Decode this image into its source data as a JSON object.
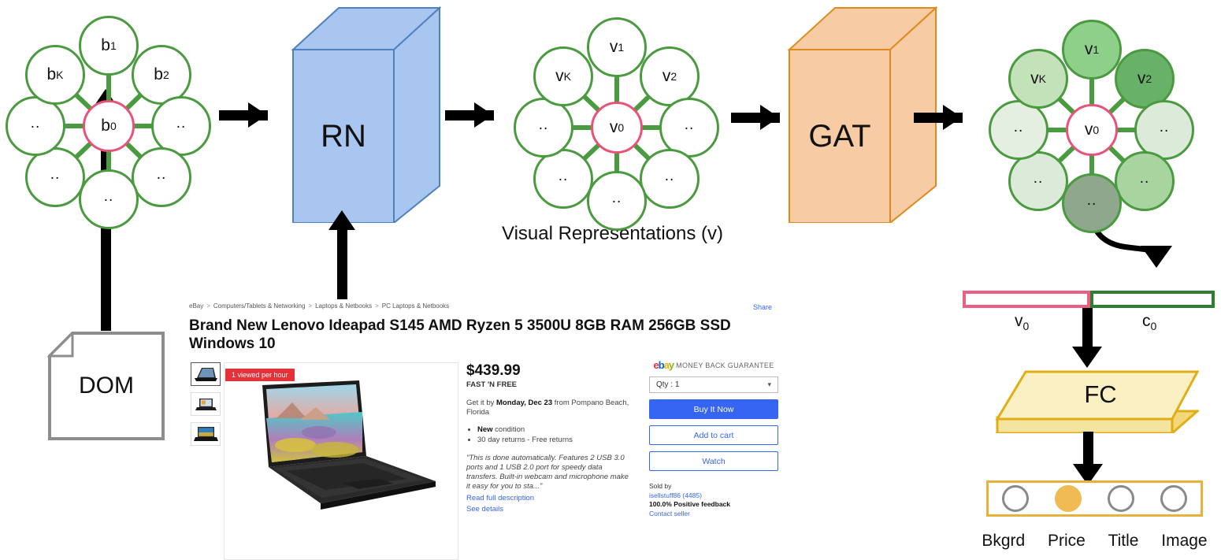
{
  "pipeline": {
    "stage1_label": "DOM",
    "rn_label": "RN",
    "gat_label": "GAT",
    "visual_caption": "Visual Representations (v)",
    "fc_label": "FC"
  },
  "graph_dom": {
    "center": "b",
    "center_sub": "0",
    "nodes": [
      {
        "label": "b",
        "sub": "1"
      },
      {
        "label": "b",
        "sub": "2"
      },
      {
        "label": "..",
        "sub": ""
      },
      {
        "label": "..",
        "sub": ""
      },
      {
        "label": "..",
        "sub": ""
      },
      {
        "label": "..",
        "sub": ""
      },
      {
        "label": "..",
        "sub": ""
      },
      {
        "label": "b",
        "sub": "K"
      }
    ]
  },
  "graph_visual": {
    "center": "v",
    "center_sub": "0",
    "nodes": [
      {
        "label": "v",
        "sub": "1"
      },
      {
        "label": "v",
        "sub": "2"
      },
      {
        "label": "..",
        "sub": ""
      },
      {
        "label": "..",
        "sub": ""
      },
      {
        "label": "..",
        "sub": ""
      },
      {
        "label": "..",
        "sub": ""
      },
      {
        "label": "..",
        "sub": ""
      },
      {
        "label": "v",
        "sub": "K"
      }
    ]
  },
  "graph_attention": {
    "center": "v",
    "center_sub": "0",
    "nodes": [
      {
        "label": "v",
        "sub": "1",
        "fill": "#8ed08a"
      },
      {
        "label": "v",
        "sub": "2",
        "fill": "#68b168"
      },
      {
        "label": "..",
        "sub": "",
        "fill": "#dcead9"
      },
      {
        "label": "..",
        "sub": "",
        "fill": "#a8d4a0"
      },
      {
        "label": "..",
        "sub": "",
        "fill": "#8fa78c"
      },
      {
        "label": "..",
        "sub": "",
        "fill": "#dcead9"
      },
      {
        "label": "..",
        "sub": "",
        "fill": "#e4efe1"
      },
      {
        "label": "v",
        "sub": "K",
        "fill": "#c4e2ba"
      }
    ]
  },
  "concat": {
    "v_label": "v",
    "v_sub": "0",
    "v_color": "#ec5f84",
    "c_label": "c",
    "c_sub": "0",
    "c_color": "#2e7d32"
  },
  "output": {
    "classes": [
      "Bkgrd",
      "Price",
      "Title",
      "Image"
    ],
    "selected_index": 1,
    "accent": "#e8b13c",
    "active_fill": "#f0bb55"
  },
  "ebay": {
    "breadcrumb": [
      "eBay",
      "Computers/Tablets & Networking",
      "Laptops & Netbooks",
      "PC Laptops & Netbooks"
    ],
    "share_label": "Share",
    "title": "Brand New Lenovo Ideapad S145 AMD Ryzen 5 3500U 8GB RAM 256GB SSD Windows 10",
    "viewed_badge": "1 viewed per hour",
    "price": "$439.99",
    "shipping_tag": "FAST 'N FREE",
    "get_it_prefix": "Get it by ",
    "get_it_date": "Monday, Dec 23",
    "get_it_suffix": " from Pompano Beach, Florida",
    "bullets": [
      {
        "strong": "New",
        "rest": " condition"
      },
      {
        "strong": "",
        "rest": "30 day returns - Free returns"
      }
    ],
    "description": "\"This is done automatically. Features 2 USB 3.0 ports and 1 USB 2.0 port for speedy data transfers. Built-in webcam and microphone make it easy for you to sta...\"",
    "read_full": "Read full description",
    "see_details": "See details",
    "guarantee_brand": "ebay",
    "guarantee_text": "MONEY BACK GUARANTEE",
    "qty_label": "Qty :  1",
    "buy_now": "Buy It Now",
    "add_to_cart": "Add to cart",
    "watch": "Watch",
    "sold_by_label": "Sold by",
    "seller_name": "isellstuff86 (4485)",
    "feedback": "100.0% Positive feedback",
    "contact_seller": "Contact seller"
  }
}
